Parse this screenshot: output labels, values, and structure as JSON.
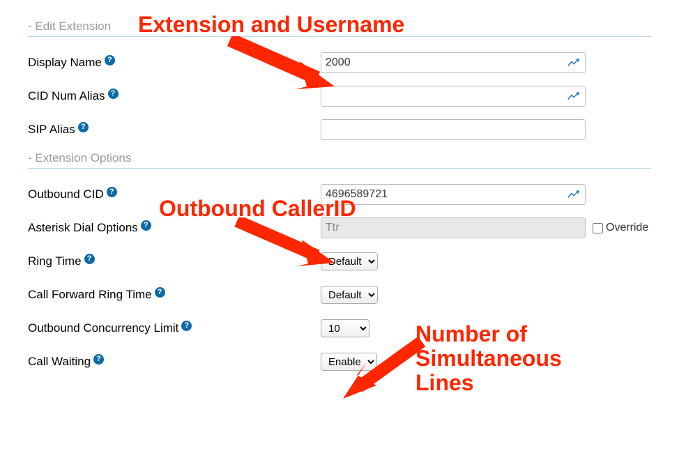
{
  "sections": {
    "edit_extension": "- Edit Extension",
    "extension_options": "- Extension Options"
  },
  "fields": {
    "display_name": {
      "label": "Display Name",
      "value": "2000"
    },
    "cid_num_alias": {
      "label": "CID Num Alias",
      "value": ""
    },
    "sip_alias": {
      "label": "SIP Alias",
      "value": ""
    },
    "outbound_cid": {
      "label": "Outbound CID",
      "value": "4696589721"
    },
    "asterisk_dial_options": {
      "label": "Asterisk Dial Options",
      "value": "Ttr",
      "override_label": "Override"
    },
    "ring_time": {
      "label": "Ring Time",
      "value": "Default"
    },
    "call_forward_ring_time": {
      "label": "Call Forward Ring Time",
      "value": "Default"
    },
    "outbound_concurrency_limit": {
      "label": "Outbound Concurrency Limit",
      "value": "10"
    },
    "call_waiting": {
      "label": "Call Waiting",
      "value": "Enable"
    }
  },
  "annotations": {
    "ext_username": "Extension and Username",
    "outbound_cid": "Outbound CallerID",
    "sim_lines_1": "Number of",
    "sim_lines_2": "Simultaneous",
    "sim_lines_3": "Lines"
  }
}
